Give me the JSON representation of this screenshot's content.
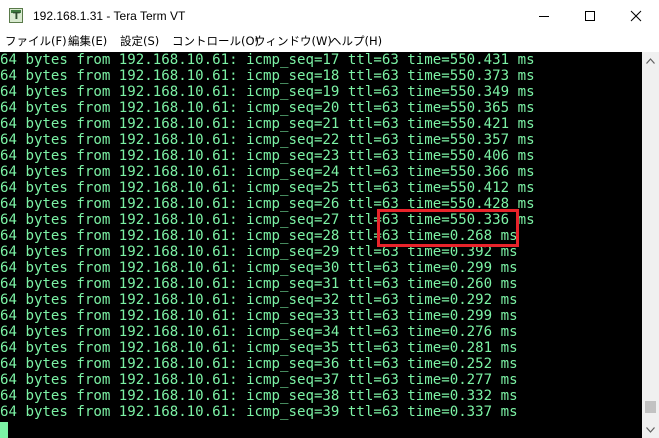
{
  "window": {
    "title": "192.168.1.31 - Tera Term VT",
    "icon_name": "tera-term-icon",
    "icon_letter": "T"
  },
  "controls": {
    "minimize_icon": "minimize-icon",
    "maximize_icon": "maximize-icon",
    "close_icon": "close-icon"
  },
  "menu": {
    "items": [
      {
        "id": "file",
        "label": "ファイル(F)"
      },
      {
        "id": "edit",
        "label": "編集(E)"
      },
      {
        "id": "setup",
        "label": "設定(S)"
      },
      {
        "id": "control",
        "label": "コントロール(O)"
      },
      {
        "id": "window",
        "label": "ウィンドウ(W)"
      },
      {
        "id": "help",
        "label": "ヘルプ(H)"
      }
    ]
  },
  "terminal": {
    "text_color": "#7cf2a5",
    "background": "#000000",
    "highlight_color": "#e8232a",
    "lines": [
      "64 bytes from 192.168.10.61: icmp_seq=17 ttl=63 time=550.431 ms",
      "64 bytes from 192.168.10.61: icmp_seq=18 ttl=63 time=550.373 ms",
      "64 bytes from 192.168.10.61: icmp_seq=19 ttl=63 time=550.349 ms",
      "64 bytes from 192.168.10.61: icmp_seq=20 ttl=63 time=550.365 ms",
      "64 bytes from 192.168.10.61: icmp_seq=21 ttl=63 time=550.421 ms",
      "64 bytes from 192.168.10.61: icmp_seq=22 ttl=63 time=550.357 ms",
      "64 bytes from 192.168.10.61: icmp_seq=23 ttl=63 time=550.406 ms",
      "64 bytes from 192.168.10.61: icmp_seq=24 ttl=63 time=550.366 ms",
      "64 bytes from 192.168.10.61: icmp_seq=25 ttl=63 time=550.412 ms",
      "64 bytes from 192.168.10.61: icmp_seq=26 ttl=63 time=550.428 ms",
      "64 bytes from 192.168.10.61: icmp_seq=27 ttl=63 time=550.336 ms",
      "64 bytes from 192.168.10.61: icmp_seq=28 ttl=63 time=0.268 ms",
      "64 bytes from 192.168.10.61: icmp_seq=29 ttl=63 time=0.392 ms",
      "64 bytes from 192.168.10.61: icmp_seq=30 ttl=63 time=0.299 ms",
      "64 bytes from 192.168.10.61: icmp_seq=31 ttl=63 time=0.260 ms",
      "64 bytes from 192.168.10.61: icmp_seq=32 ttl=63 time=0.292 ms",
      "64 bytes from 192.168.10.61: icmp_seq=33 ttl=63 time=0.299 ms",
      "64 bytes from 192.168.10.61: icmp_seq=34 ttl=63 time=0.276 ms",
      "64 bytes from 192.168.10.61: icmp_seq=35 ttl=63 time=0.281 ms",
      "64 bytes from 192.168.10.61: icmp_seq=36 ttl=63 time=0.252 ms",
      "64 bytes from 192.168.10.61: icmp_seq=37 ttl=63 time=0.277 ms",
      "64 bytes from 192.168.10.61: icmp_seq=38 ttl=63 time=0.332 ms",
      "64 bytes from 192.168.10.61: icmp_seq=39 ttl=63 time=0.337 ms"
    ]
  },
  "scrollbar": {
    "up_icon": "scroll-up-arrow-icon",
    "down_icon": "scroll-down-arrow-icon"
  }
}
